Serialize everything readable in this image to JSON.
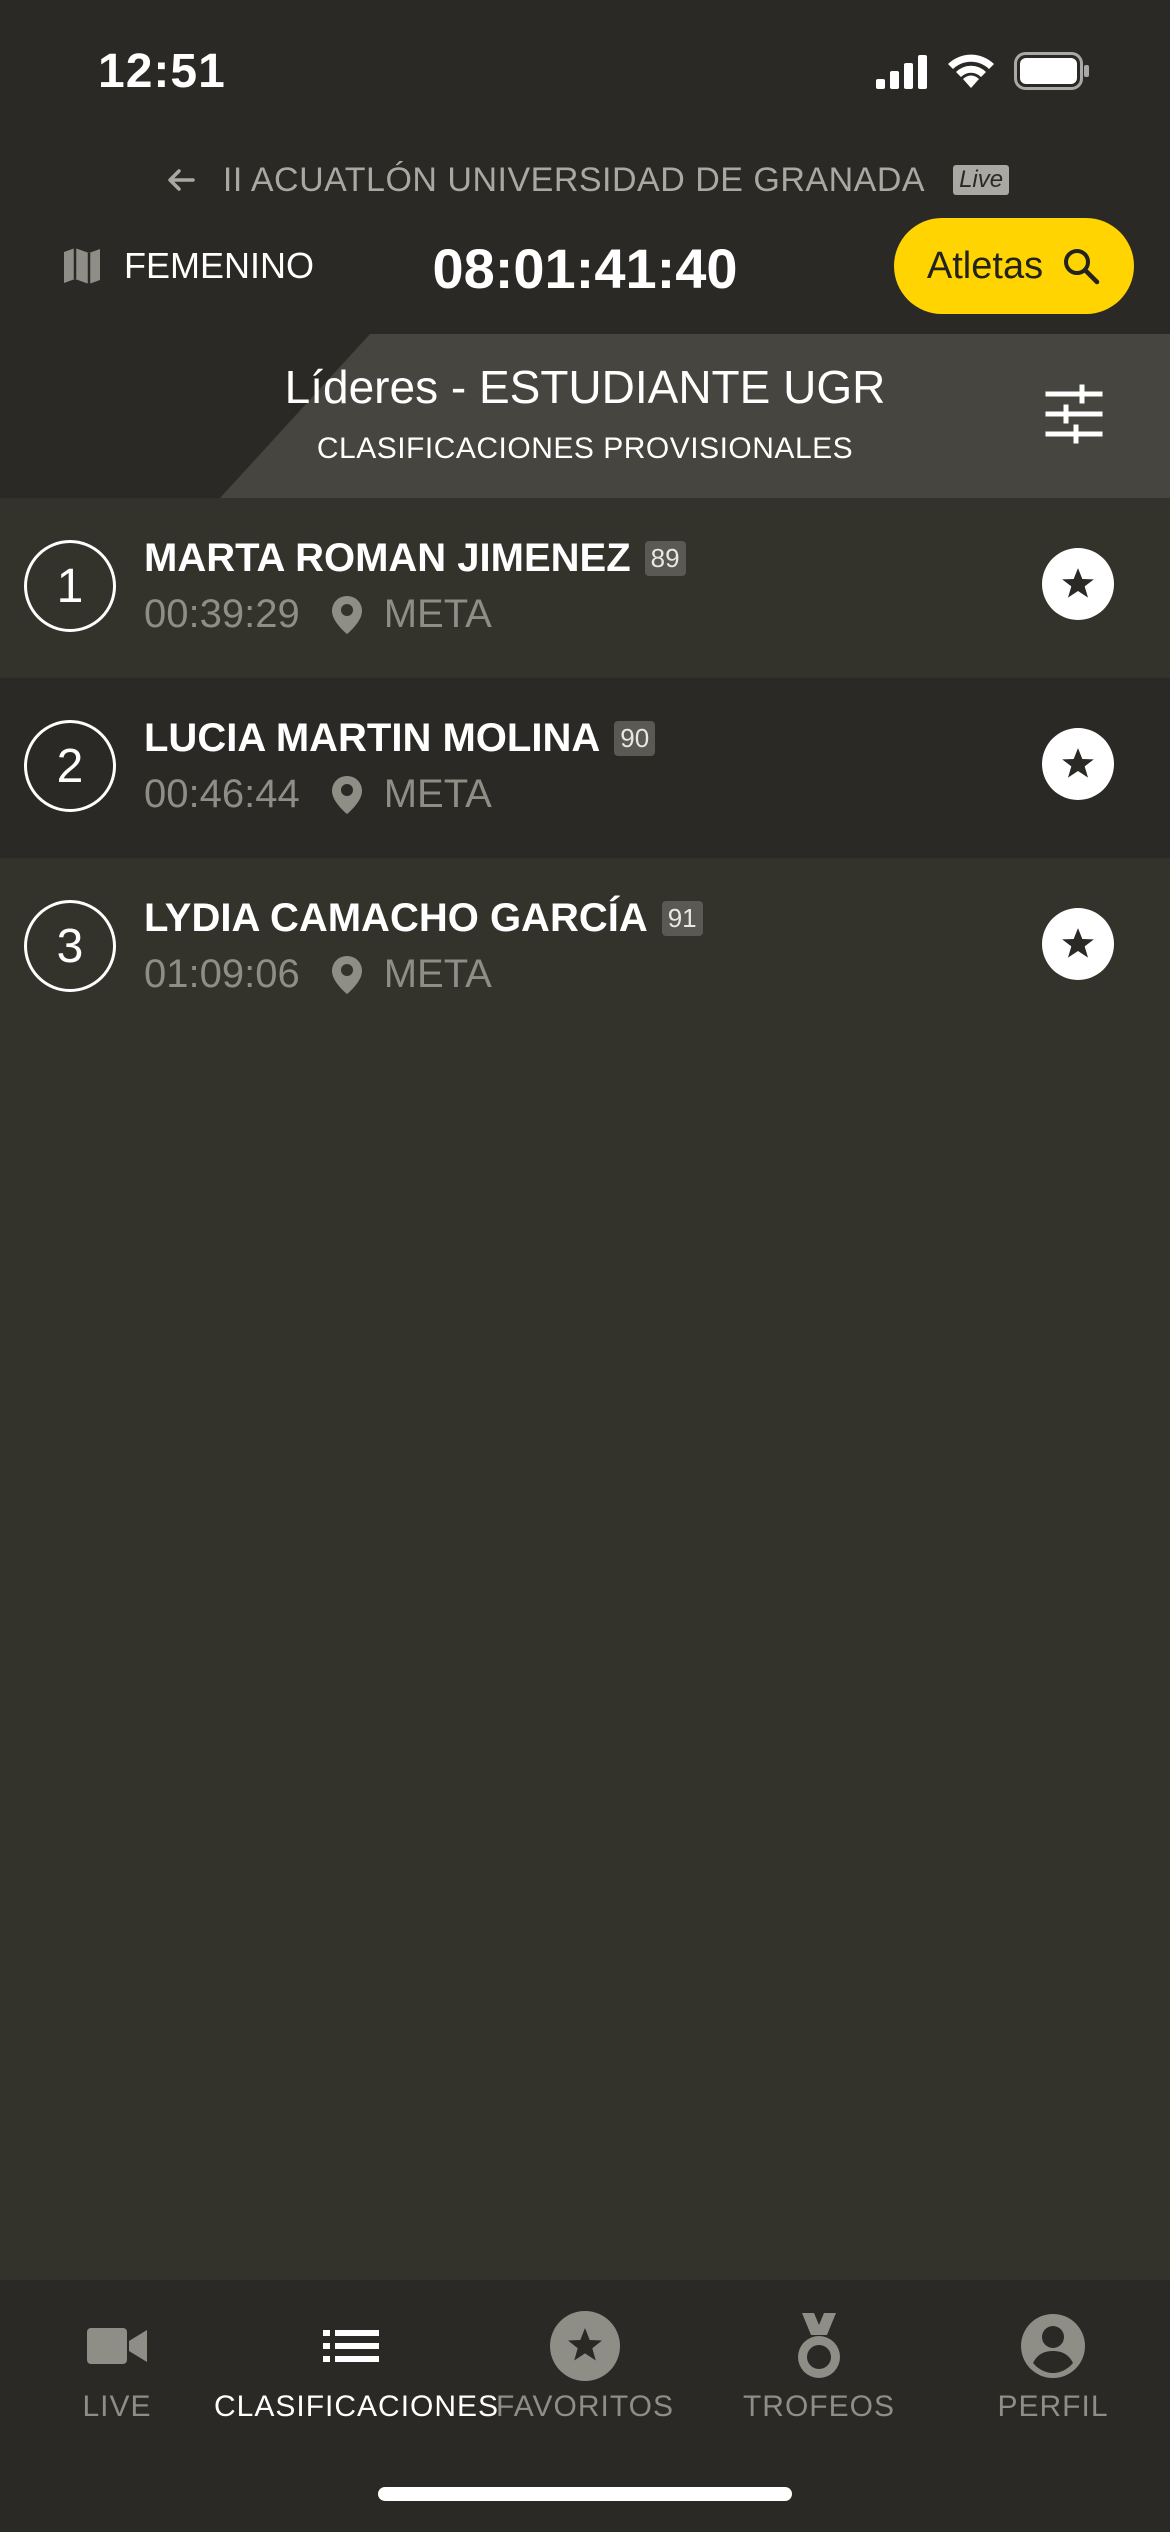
{
  "status_bar": {
    "time": "12:51"
  },
  "header": {
    "event_title": "II ACUATLÓN UNIVERSIDAD DE GRANADA",
    "live_badge": "Live",
    "category": "FEMENINO",
    "race_clock": "08:01:41:40",
    "athletes_button": "Atletas"
  },
  "leaders": {
    "title": "Líderes - ESTUDIANTE UGR",
    "subtitle": "CLASIFICACIONES PROVISIONALES"
  },
  "results": [
    {
      "position": "1",
      "name": "MARTA ROMAN JIMENEZ",
      "bib": "89",
      "time": "00:39:29",
      "location": "META"
    },
    {
      "position": "2",
      "name": "LUCIA MARTIN MOLINA",
      "bib": "90",
      "time": "00:46:44",
      "location": "META"
    },
    {
      "position": "3",
      "name": "LYDIA CAMACHO GARCÍA",
      "bib": "91",
      "time": "01:09:06",
      "location": "META"
    }
  ],
  "tabs": [
    {
      "label": "LIVE",
      "icon": "video-camera-icon"
    },
    {
      "label": "CLASIFICACIONES",
      "icon": "list-icon",
      "active": true
    },
    {
      "label": "FAVORITOS",
      "icon": "star-icon"
    },
    {
      "label": "TROFEOS",
      "icon": "medal-icon"
    },
    {
      "label": "PERFIL",
      "icon": "account-icon"
    }
  ],
  "colors": {
    "accent": "#ffd400",
    "background": "#33332c",
    "bar": "#2a2925"
  }
}
